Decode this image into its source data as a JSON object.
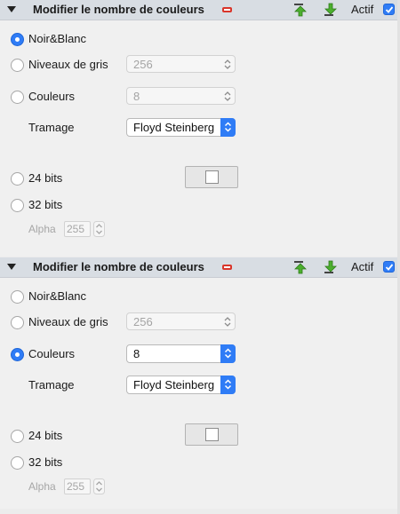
{
  "panels": [
    {
      "title": "Modifier le nombre de couleurs",
      "actif_label": "Actif",
      "actif_checked": true,
      "options": {
        "noir_blanc": "Noir&Blanc",
        "niveaux_gris": "Niveaux de gris",
        "couleurs": "Couleurs",
        "bits24": "24 bits",
        "bits32": "32 bits"
      },
      "selected": "noir_blanc",
      "niveaux_value": "256",
      "couleurs_value": "8",
      "tramage_label": "Tramage",
      "tramage_value": "Floyd Steinberg",
      "alpha_label": "Alpha",
      "alpha_value": "255"
    },
    {
      "title": "Modifier le nombre de couleurs",
      "actif_label": "Actif",
      "actif_checked": true,
      "options": {
        "noir_blanc": "Noir&Blanc",
        "niveaux_gris": "Niveaux de gris",
        "couleurs": "Couleurs",
        "bits24": "24 bits",
        "bits32": "32 bits"
      },
      "selected": "couleurs",
      "niveaux_value": "256",
      "couleurs_value": "8",
      "tramage_label": "Tramage",
      "tramage_value": "Floyd Steinberg",
      "alpha_label": "Alpha",
      "alpha_value": "255"
    }
  ],
  "icons": {
    "collapse": "disclosure-triangle-icon",
    "remove": "remove-icon",
    "move_up": "move-up-icon",
    "move_down": "move-down-icon"
  },
  "colors": {
    "accent": "#2f7cf6",
    "header_bg": "#d8dde3",
    "remove_red": "#d9362b",
    "arrow_green": "#3aa02d"
  }
}
